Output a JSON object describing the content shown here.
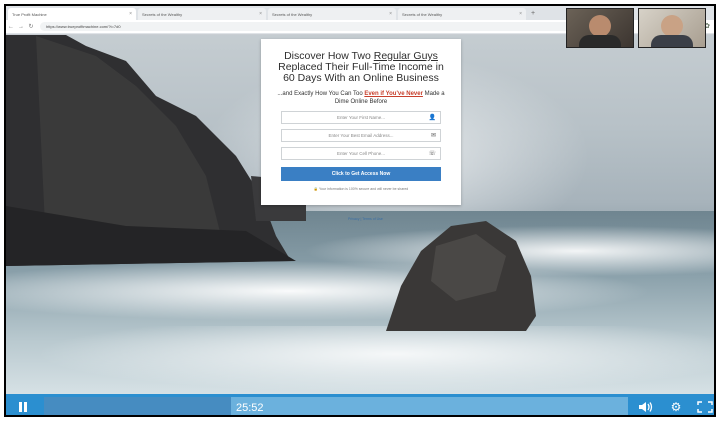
{
  "browser": {
    "tabs": [
      {
        "label": "True Profit Machine",
        "active": true
      },
      {
        "label": "Secrets of the Wealthy",
        "active": false
      },
      {
        "label": "Secrets of the Wealthy",
        "active": false
      },
      {
        "label": "Secrets of the Wealthy",
        "active": false
      }
    ],
    "new_tab": "+",
    "url": "https://www.trueprofitmachine.com/?t=7d0"
  },
  "optin": {
    "headline_part1": "Discover How Two ",
    "headline_emph": "Regular Guys",
    "headline_part2": " Replaced Their Full-Time Income in 60 Days With an Online Business",
    "sub_part1": "...and Exactly How You Can Too ",
    "sub_emph": "Even if You've Never",
    "sub_part2": " Made a Dime Online Before",
    "fields": [
      {
        "placeholder": "Enter Your First Name...",
        "icon": "user-icon"
      },
      {
        "placeholder": "Enter Your Best Email Address...",
        "icon": "envelope-icon"
      },
      {
        "placeholder": "Enter Your Cell Phone...",
        "icon": "phone-icon"
      }
    ],
    "cta_label": "Click to Get Access Now",
    "privacy_note": "Your information is 100% secure and will never be shared",
    "footer_links": "Privacy | Terms of Use",
    "accent_color": "#c8402d",
    "button_color": "#3a7fc4"
  },
  "player": {
    "time": "25:52",
    "progress_fraction": 0.32,
    "play_state": "playing",
    "control_color": "#2b8fd0"
  }
}
